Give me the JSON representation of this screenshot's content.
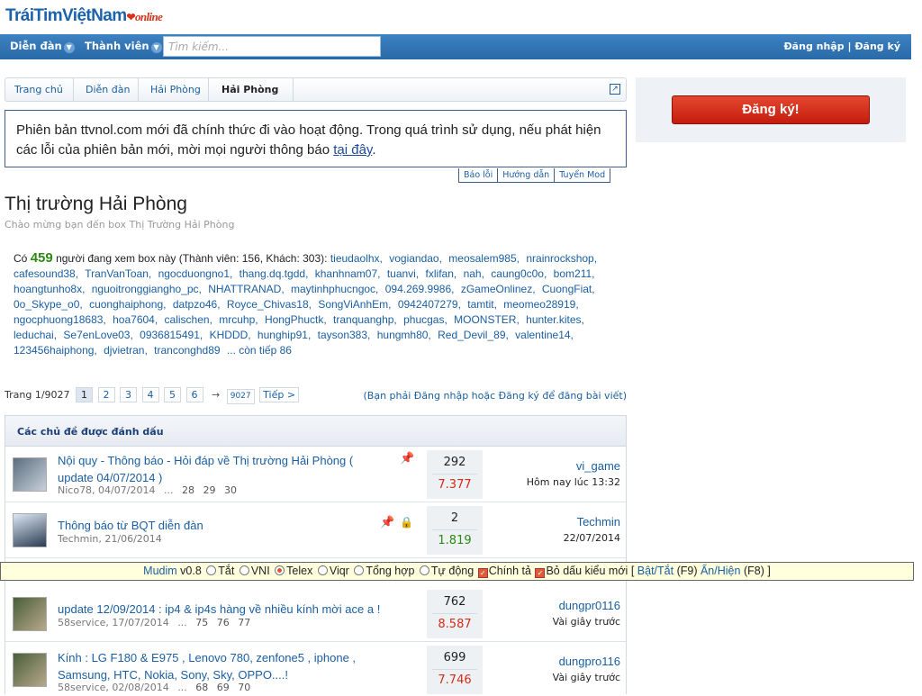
{
  "logo": {
    "text": "TráiTimViệtNam",
    "suffix": "online"
  },
  "nav": {
    "forum": "Diễn đàn",
    "members": "Thành viên",
    "search_placeholder": "Tìm kiếm...",
    "login": "Đăng nhập",
    "sep": "|",
    "register": "Đăng ký"
  },
  "breadcrumb": [
    "Trang chủ",
    "Diễn đàn",
    "Hải Phòng",
    "Hải Phòng"
  ],
  "notice": {
    "text": "Phiên bản ttvnol.com mới đã chính thức đi vào hoạt động. Trong quá trình sử dụng, nếu phát hiện các lỗi của phiên bản mới, mời mọi người thông báo ",
    "link": "tại đây",
    "end": ".",
    "tabs": [
      "Báo lỗi",
      "Hướng dẫn",
      "Tuyển Mod"
    ]
  },
  "register_button": "Đăng ký!",
  "forum": {
    "title": "Thị trường Hải Phòng",
    "subtitle": "Chào mừng bạn đến box Thị Trường Hải Phòng"
  },
  "viewers": {
    "prefix": "Có",
    "count": "459",
    "suffix": "người đang xem box này (Thành viên: 156, Khách: 303):",
    "names": [
      "tieudaolhx",
      "vogiandao",
      "meosalem985",
      "nrainrockshop",
      "cafesound38",
      "TranVanToan",
      "ngocduongno1",
      "thang.dq.tgdd",
      "khanhnam07",
      "tuanvi",
      "fxlifan",
      "nah",
      "caung0c0o",
      "bom211",
      "hoangtunho8x",
      "nguoitronggiangho_pc",
      "NHATTRANAD",
      "maytinhphucngoc",
      "094.269.9986",
      "zGameOnlinez",
      "CuongFiat",
      "0o_Skype_o0",
      "cuonghaiphong",
      "datpzo46",
      "Royce_Chivas18",
      "SongViAnhEm",
      "0942407279",
      "tamtit",
      "meomeo28919",
      "ngocphuong18683",
      "hoa7604",
      "calischen",
      "mrcuhp",
      "HongPhuctk",
      "tranquanghp",
      "phucgas",
      "MOONSTER",
      "hunter.kites",
      "leduchai",
      "Se7enLove03",
      "0936815491",
      "KHDDD",
      "hunghip91",
      "tayson383",
      "hungmh80",
      "Red_Devil_89",
      "valentine14",
      "123456haiphong",
      "djvietran",
      "tranconghd89"
    ],
    "more": "... còn tiếp 86"
  },
  "pager": {
    "label": "Trang 1/9027",
    "pages": [
      "1",
      "2",
      "3",
      "4",
      "5",
      "6"
    ],
    "arrow": "→",
    "last": "9027",
    "next": "Tiếp >",
    "note": "(Bạn phải Đăng nhập hoặc Đăng ký để đăng bài viết)"
  },
  "threads": {
    "header": "Các chủ đề được đánh dấu",
    "items": [
      {
        "title": "Nội quy - Thông báo - Hỏi đáp về Thị trường Hải Phòng ( update 04/07/2014 )",
        "meta": "Nico78, 04/07/2014",
        "pages": [
          "28",
          "29",
          "30"
        ],
        "replies": "292",
        "views": "7.377",
        "views_color": "#d12b1b",
        "last_user": "vi_game",
        "last_time": "Hôm nay lúc 13:32"
      },
      {
        "title": "Thông báo từ BQT diễn đàn",
        "meta": "Techmin, 21/06/2014",
        "pages": [],
        "replies": "2",
        "views": "1.819",
        "views_color": "#2a8a12",
        "last_user": "Techmin",
        "last_time": "22/07/2014"
      },
      {
        "title": "update 12/09/2014 : ip4 & ip4s hàng về nhiều kính mời ace a !",
        "meta": "58service, 17/07/2014",
        "pages": [
          "75",
          "76",
          "77"
        ],
        "replies": "762",
        "views": "8.587",
        "views_color": "#d12b1b",
        "last_user": "dungpr0116",
        "last_time": "Vài giây trước"
      },
      {
        "title": "Kính : LG F180 & E975 , Lenovo 780, zenfone5 , iphone , Samsung, HTC, Nokia, Sony, Sky, OPPO....!",
        "meta": "58service, 02/08/2014",
        "pages": [
          "68",
          "69",
          "70"
        ],
        "replies": "699",
        "views": "7.746",
        "views_color": "#d12b1b",
        "last_user": "dungpro116",
        "last_time": "Vài giây trước"
      }
    ]
  },
  "mudim": {
    "name": "Mudim",
    "version": "v0.8",
    "opts": [
      "Tắt",
      "VNI",
      "Telex",
      "Viqr",
      "Tổng hợp",
      "Tự động"
    ],
    "chk1": "Chính tả",
    "chk2": "Bỏ dấu kiểu mới",
    "bracket_open": "[",
    "toggle": "Bật/Tắt",
    "f9": "(F9)",
    "hide": "Ẩn/Hiện",
    "f8": "(F8)",
    "bracket_close": "]"
  }
}
